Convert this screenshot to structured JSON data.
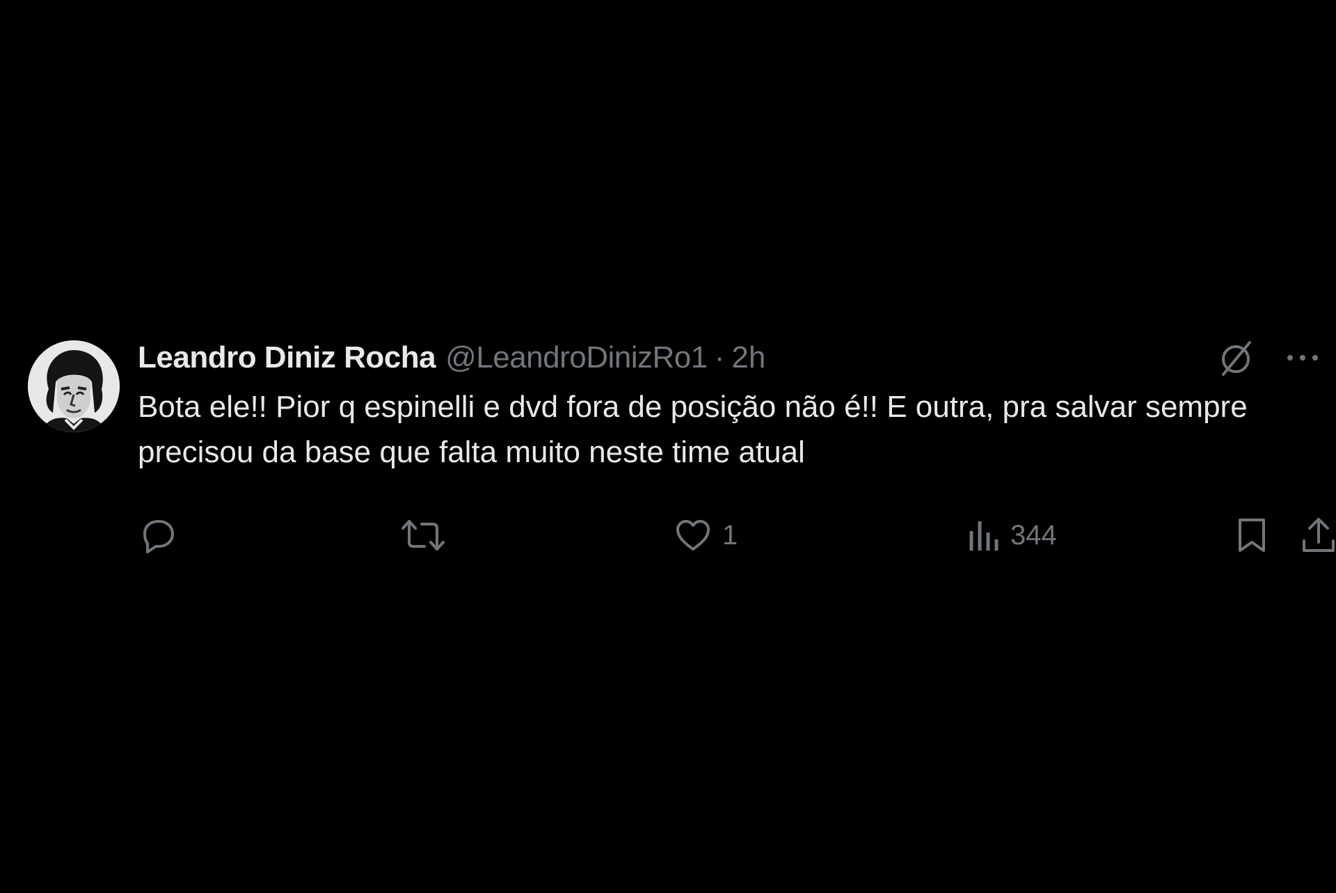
{
  "tweet": {
    "display_name": "Leandro Diniz Rocha",
    "handle": "@LeandroDinizRo1",
    "separator": "·",
    "time": "2h",
    "text": "Bota ele!! Pior q espinelli e dvd fora de posição não é!! E outra, pra salvar sempre precisou da base que falta muito neste time atual",
    "avatar_icon": "avatar-portrait",
    "header_icons": [
      "grok-icon",
      "more-icon"
    ]
  },
  "actions": {
    "reply": {
      "icon": "reply-icon",
      "count": ""
    },
    "repost": {
      "icon": "repost-icon",
      "count": ""
    },
    "like": {
      "icon": "heart-icon",
      "count": "1"
    },
    "views": {
      "icon": "views-icon",
      "count": "344"
    },
    "bookmark": {
      "icon": "bookmark-icon"
    },
    "share": {
      "icon": "share-icon"
    }
  },
  "colors": {
    "background": "#000000",
    "primary_text": "#e7e9ea",
    "secondary_text": "#71767b"
  }
}
